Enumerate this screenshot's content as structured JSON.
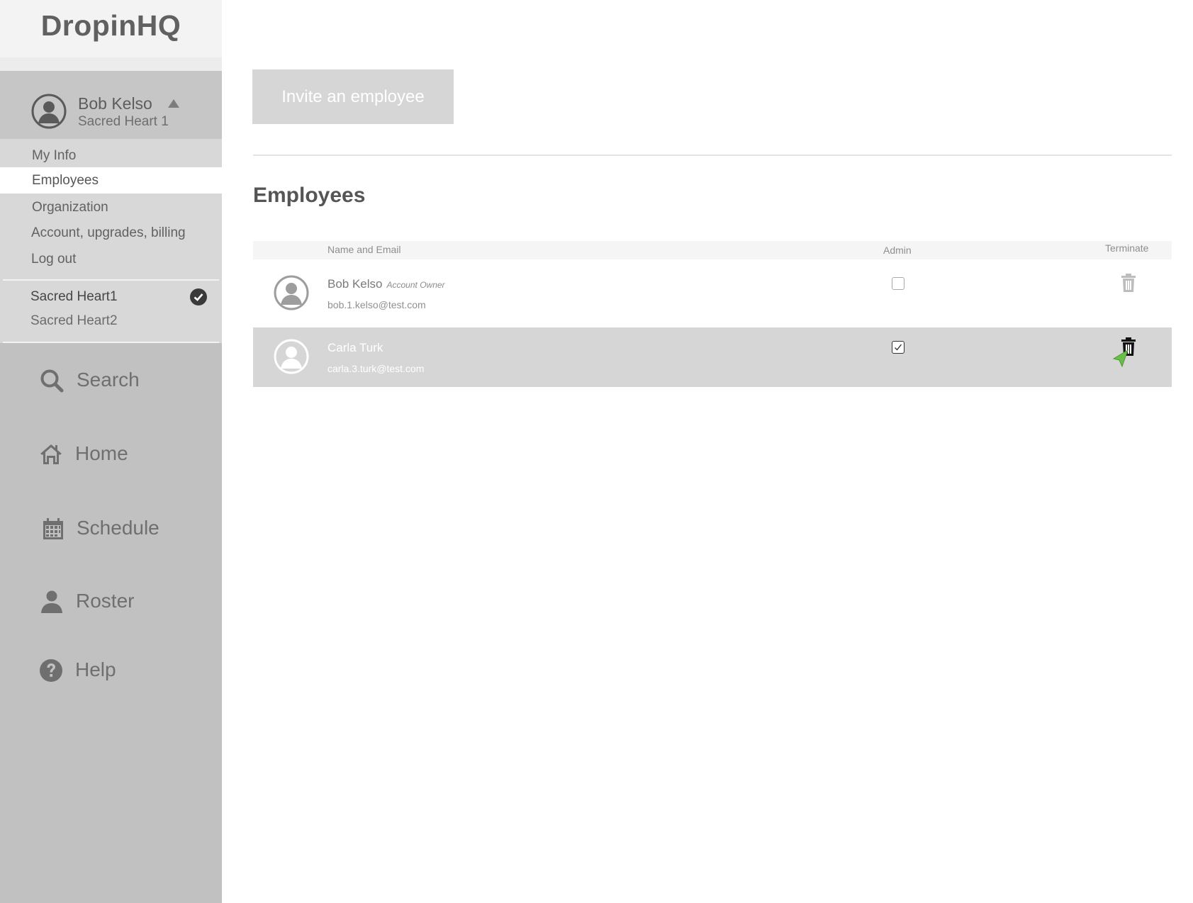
{
  "app": {
    "brand": "DropinHQ"
  },
  "sidebar": {
    "user": {
      "name": "Bob Kelso",
      "organization": "Sacred Heart 1"
    },
    "menu": [
      {
        "label": "My Info"
      },
      {
        "label": "Employees",
        "active": true
      },
      {
        "label": "Organization"
      },
      {
        "label": "Account, upgrades, billing"
      },
      {
        "label": "Log out"
      }
    ],
    "organizations": [
      {
        "label": "Sacred Heart1",
        "selected": true
      },
      {
        "label": "Sacred Heart2",
        "selected": false
      }
    ],
    "nav": [
      {
        "label": "Search",
        "icon": "search-icon"
      },
      {
        "label": "Home",
        "icon": "home-icon"
      },
      {
        "label": "Schedule",
        "icon": "calendar-icon"
      },
      {
        "label": "Roster",
        "icon": "person-icon"
      },
      {
        "label": "Help",
        "icon": "help-icon"
      }
    ]
  },
  "main": {
    "invite_button": "Invite an employee",
    "section_title": "Employees",
    "table": {
      "columns": {
        "name_email": "Name and Email",
        "admin": "Admin",
        "terminate": "Terminate"
      },
      "rows": [
        {
          "name": "Bob Kelso",
          "badge": "Account Owner",
          "email": "bob.1.kelso@test.com",
          "admin": false,
          "selected": false
        },
        {
          "name": "Carla Turk",
          "badge": "",
          "email": "carla.3.turk@test.com",
          "admin": true,
          "selected": true
        }
      ]
    }
  },
  "colors": {
    "sidebar": "#c1c1c1",
    "menu": "#d8d8d8",
    "selected_row": "#d6d6d6",
    "cursor": "#6abf4b"
  }
}
